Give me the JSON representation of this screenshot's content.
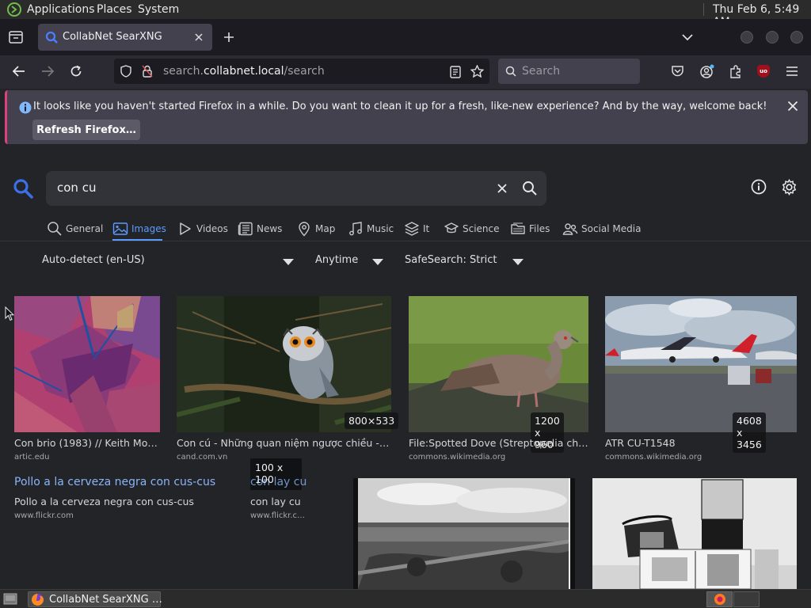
{
  "panel": {
    "applications": "Applications",
    "places": "Places",
    "system": "System",
    "clock": "Thu Feb  6,  5:49 AM"
  },
  "browser": {
    "tab_title": "CollabNet SearXNG",
    "url_prefix": "search.",
    "url_host": "collabnet.local",
    "url_path": "/search",
    "search_placeholder": "Search"
  },
  "notification": {
    "message": "It looks like you haven't started Firefox in a while. Do you want to clean it up for a fresh, like-new experience? And by the way, welcome back!",
    "button": "Refresh Firefox…"
  },
  "searx": {
    "query": "con cu",
    "categories": [
      {
        "label": "General",
        "icon": "search-icon"
      },
      {
        "label": "Images",
        "icon": "image-icon",
        "active": true
      },
      {
        "label": "Videos",
        "icon": "play-icon"
      },
      {
        "label": "News",
        "icon": "newspaper-icon"
      },
      {
        "label": "Map",
        "icon": "map-pin-icon"
      },
      {
        "label": "Music",
        "icon": "music-icon"
      },
      {
        "label": "It",
        "icon": "layers-icon"
      },
      {
        "label": "Science",
        "icon": "science-icon"
      },
      {
        "label": "Files",
        "icon": "files-icon"
      },
      {
        "label": "Social Media",
        "icon": "people-icon"
      }
    ],
    "filters": {
      "language": "Auto-detect (en-US)",
      "time": "Anytime",
      "safesearch": "SafeSearch: Strict"
    },
    "results": [
      {
        "title": "Con brio (1983) // Keith Morri…",
        "source": "artic.edu",
        "size": ""
      },
      {
        "title": "Con cú - Những quan niệm ngược chiều - Bá…",
        "source": "cand.com.vn",
        "size": "800×533"
      },
      {
        "title": "File:Spotted Dove (Streptopelia chine…",
        "source": "commons.wikimedia.org",
        "size": "1200 x 960"
      },
      {
        "title": "ATR CU-T1548",
        "source": "commons.wikimedia.org",
        "size": "4608 x 3456"
      },
      {
        "link_title": "Pollo a la cerveza negra con cus-cus",
        "title": "Pollo a la cerveza negra con cus-cus",
        "source": "www.flickr.com"
      },
      {
        "link_title": "con lay cu",
        "title": "con lay cu",
        "source": "www.flickr.c…",
        "size": "100 x 100"
      }
    ]
  },
  "taskbar": {
    "window_title": "CollabNet SearXNG …"
  },
  "colors": {
    "accent": "#5b9aff",
    "link": "#8ab4f8",
    "notification_stripe": "#e04080"
  }
}
